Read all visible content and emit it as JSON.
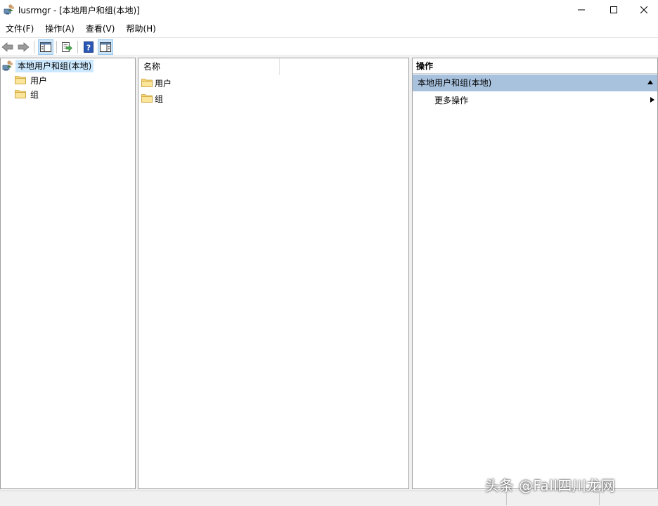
{
  "window": {
    "title": "lusrmgr - [本地用户和组(本地)]",
    "icon": "users-computer-icon"
  },
  "menu": [
    {
      "label": "文件(F)"
    },
    {
      "label": "操作(A)"
    },
    {
      "label": "查看(V)"
    },
    {
      "label": "帮助(H)"
    }
  ],
  "toolbar": {
    "buttons": [
      "back-arrow-icon",
      "forward-arrow-icon",
      "show-hide-tree-icon",
      "export-list-icon",
      "help-icon",
      "show-hide-action-pane-icon"
    ]
  },
  "tree": {
    "root": {
      "label": "本地用户和组(本地)",
      "icon": "users-computer-icon"
    },
    "children": [
      {
        "label": "用户",
        "icon": "folder-icon"
      },
      {
        "label": "组",
        "icon": "folder-icon"
      }
    ]
  },
  "list": {
    "column_header": "名称",
    "items": [
      {
        "label": "用户",
        "icon": "folder-icon"
      },
      {
        "label": "组",
        "icon": "folder-icon"
      }
    ]
  },
  "actions": {
    "header": "操作",
    "section_title": "本地用户和组(本地)",
    "items": [
      {
        "label": "更多操作"
      }
    ]
  },
  "watermark": "头条 @Fall四川龙网"
}
